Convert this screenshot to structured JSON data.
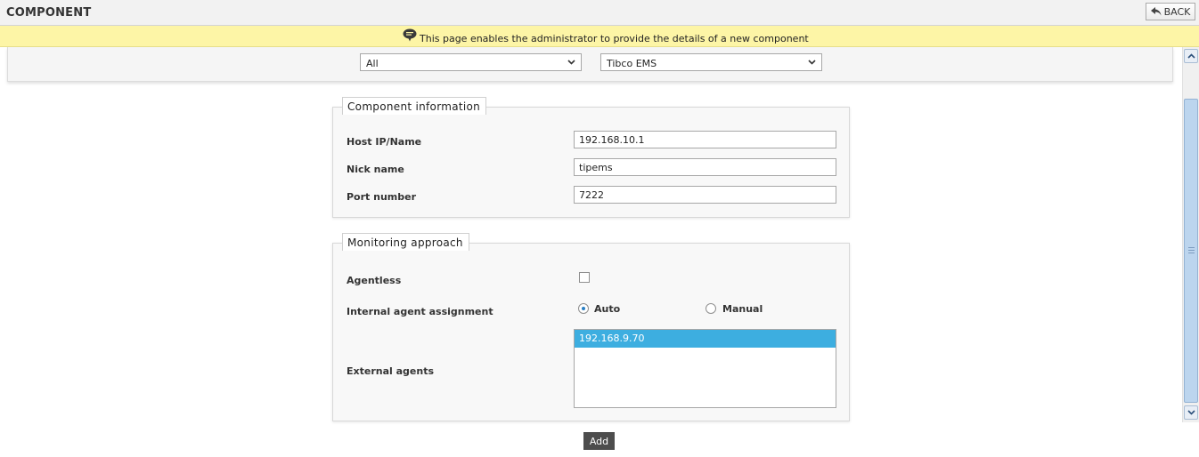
{
  "header": {
    "title": "COMPONENT",
    "back_label": "BACK"
  },
  "banner": {
    "text": "This page enables the administrator to provide the details of a new component"
  },
  "filters": {
    "group_select": {
      "value": "All"
    },
    "type_select": {
      "value": "Tibco EMS"
    }
  },
  "component_information": {
    "legend": "Component information",
    "host_label": "Host IP/Name",
    "host_value": "192.168.10.1",
    "nick_label": "Nick name",
    "nick_value": "tipems",
    "port_label": "Port number",
    "port_value": "7222"
  },
  "monitoring_approach": {
    "legend": "Monitoring approach",
    "agentless_label": "Agentless",
    "internal_label": "Internal agent assignment",
    "auto_label": "Auto",
    "manual_label": "Manual",
    "external_label": "External agents",
    "external_agents": [
      "192.168.9.70"
    ]
  },
  "actions": {
    "add_label": "Add"
  },
  "colors": {
    "banner_bg": "#fdf5a6",
    "selected_bg": "#3daee0",
    "add_bg": "#4d4d4d"
  }
}
